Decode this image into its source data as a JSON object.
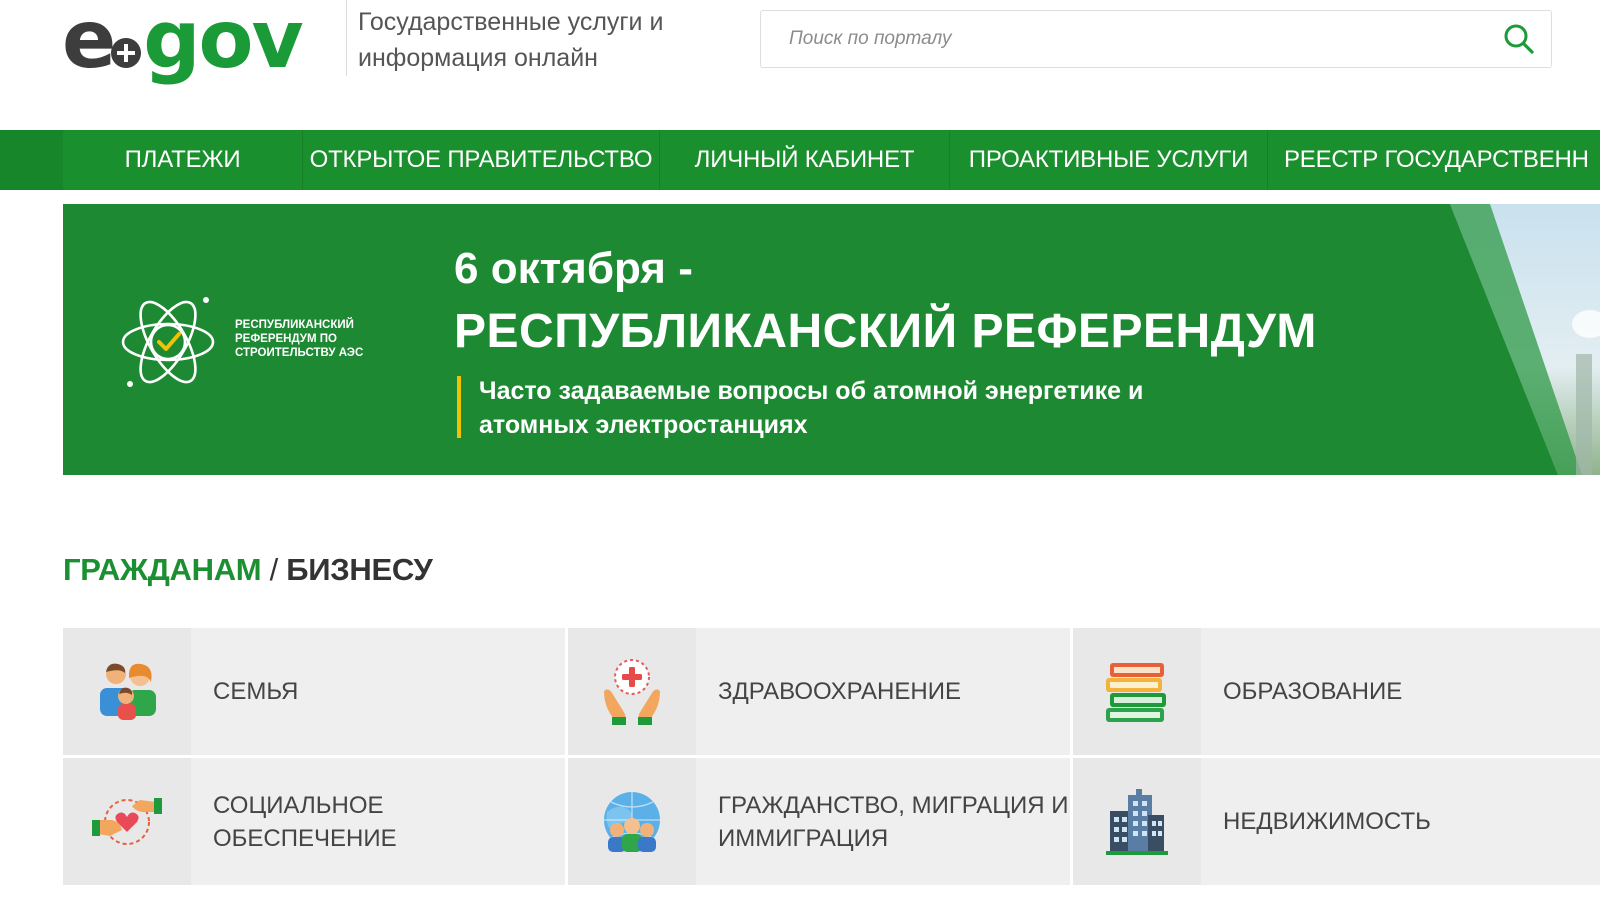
{
  "header": {
    "logo": {
      "e": "e",
      "gov": "gov"
    },
    "tagline": "Государственные услуги и информация онлайн",
    "search": {
      "placeholder": "Поиск по порталу",
      "value": ""
    }
  },
  "nav": {
    "items": [
      {
        "label": "ПЛАТЕЖИ"
      },
      {
        "label": "ОТКРЫТОЕ ПРАВИТЕЛЬСТВО"
      },
      {
        "label": "ЛИЧНЫЙ КАБИНЕТ"
      },
      {
        "label": "ПРОАКТИВНЫЕ УСЛУГИ"
      },
      {
        "label": "РЕЕСТР ГОСУДАРСТВЕНН"
      }
    ]
  },
  "banner": {
    "emblem_text": "РЕСПУБЛИКАНСКИЙ РЕФЕРЕНДУМ ПО СТРОИТЕЛЬСТВУ АЭС",
    "date": "6 октября -",
    "title": "РЕСПУБЛИКАНСКИЙ РЕФЕРЕНДУМ",
    "subtitle": "Часто задаваемые вопросы об атомной энергетике и атомных электростанциях",
    "accent_color": "#f2c200",
    "background_color": "#1d8a33"
  },
  "section": {
    "citizens": "ГРАЖДАНАМ",
    "separator": "/",
    "business": "БИЗНЕСУ"
  },
  "categories": [
    {
      "label": "СЕМЬЯ",
      "icon": "family-icon"
    },
    {
      "label": "ЗДРАВООХРАНЕНИЕ",
      "icon": "healthcare-icon"
    },
    {
      "label": "ОБРАЗОВАНИЕ",
      "icon": "education-icon"
    },
    {
      "label": "СОЦИАЛЬНОЕ ОБЕСПЕЧЕНИЕ",
      "icon": "social-security-icon"
    },
    {
      "label": "ГРАЖДАНСТВО, МИГРАЦИЯ И ИММИГРАЦИЯ",
      "icon": "migration-icon"
    },
    {
      "label": "НЕДВИЖИМОСТЬ",
      "icon": "real-estate-icon"
    }
  ],
  "colors": {
    "brand_green": "#1b9b37",
    "nav_green": "#1a8f2e",
    "card_bg": "#efefef"
  }
}
